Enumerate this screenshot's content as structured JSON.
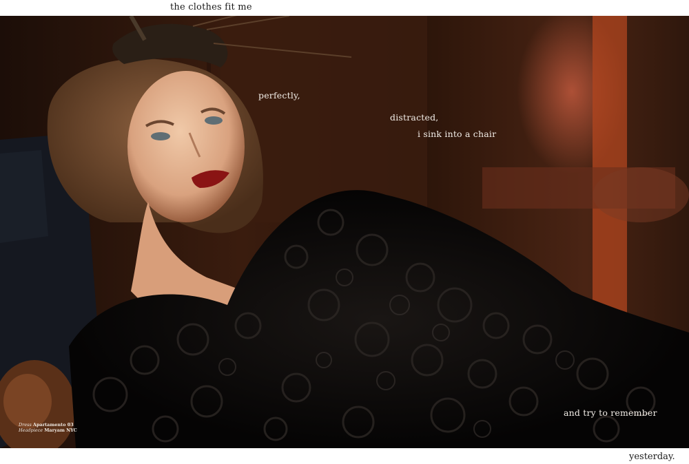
{
  "header": {
    "text": "the clothes fit me"
  },
  "overlays": {
    "perfectly": "perfectly,",
    "distracted": "distracted,",
    "sink": "i sink into a chair",
    "remember": "and try to remember"
  },
  "credits": {
    "line1_label": "Dress",
    "line1_value": "Apartamento 03",
    "line2_label": "Headpiece",
    "line2_value": "Maryam NYC"
  },
  "footer": {
    "text": "yesterday."
  },
  "colors": {
    "background": "#ffffff",
    "text_dark": "#1a1a1a",
    "overlay_text": "#f3eee8"
  }
}
